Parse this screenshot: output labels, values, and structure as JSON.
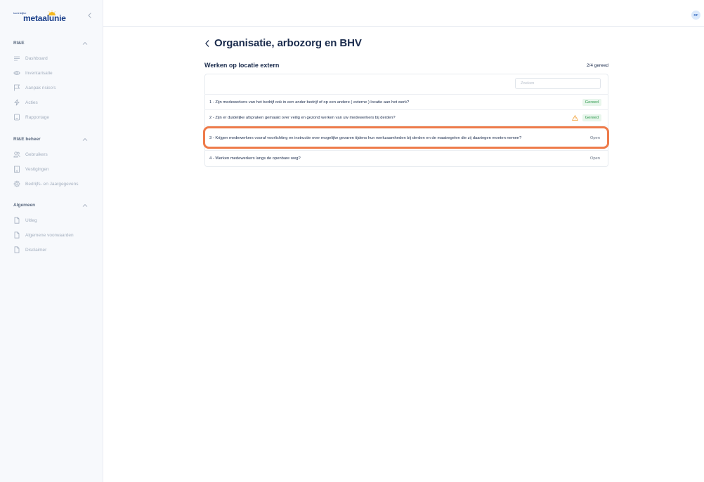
{
  "app": {
    "logo_small": "koninklijke",
    "logo_big": "metaalunie",
    "avatar_initials": "RF"
  },
  "sidebar": {
    "sections": [
      {
        "title": "RI&E",
        "items": [
          {
            "label": "Dashboard",
            "icon": "menu-lines-icon"
          },
          {
            "label": "Inventarisatie",
            "icon": "eye-icon"
          },
          {
            "label": "Aanpak risico's",
            "icon": "flag-icon"
          },
          {
            "label": "Acties",
            "icon": "lightning-icon"
          },
          {
            "label": "Rapportage",
            "icon": "document-icon"
          }
        ]
      },
      {
        "title": "RI&E beheer",
        "items": [
          {
            "label": "Gebruikers",
            "icon": "users-icon"
          },
          {
            "label": "Vestigingen",
            "icon": "building-icon"
          },
          {
            "label": "Bedrijfs- en Jaargegevens",
            "icon": "gear-icon"
          }
        ]
      },
      {
        "title": "Algemeen",
        "items": [
          {
            "label": "Uitleg",
            "icon": "file-icon"
          },
          {
            "label": "Algemene voorwaarden",
            "icon": "file-icon"
          },
          {
            "label": "Disclaimer",
            "icon": "file-icon"
          }
        ]
      }
    ]
  },
  "main": {
    "title": "Organisatie, arbozorg en BHV",
    "subtitle": "Werken op locatie extern",
    "progress": "2/4 gereed",
    "search_placeholder": "Zoeken",
    "questions": [
      {
        "text": "1 - Zijn medewerkers van het bedrijf ook in een ander bedrijf of op een andere ( externe ) locatie aan het werk?",
        "status": "Gereed",
        "warning": false
      },
      {
        "text": "2 - Zijn er duidelijke afspraken gemaakt over veilig en gezond werken van uw medewerkers bij derden?",
        "status": "Gereed",
        "warning": true
      },
      {
        "text": "3 - Krijgen medewerkers vooraf voorlichting en instructie over mogelijke gevaren tijdens hun werkzaamheden bij derden en de maatregelen die zij daartegen moeten nemen?",
        "status": "Open",
        "warning": false
      },
      {
        "text": "4 - Werken medewerkers langs de openbare weg?",
        "status": "Open",
        "warning": false
      }
    ]
  },
  "colors": {
    "accent_navy": "#1a2b4c",
    "brand_blue": "#1a3f8a",
    "done_green": "#2e9a4d",
    "warning_orange": "#f2a33a",
    "highlight_orange": "#ee7b4a"
  }
}
